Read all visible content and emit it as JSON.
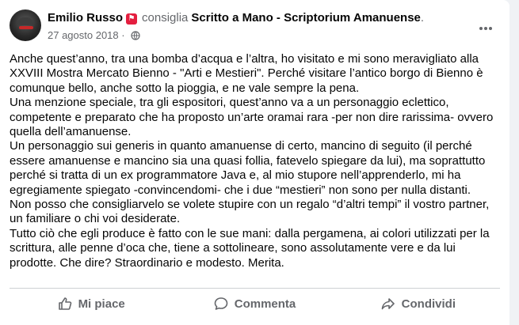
{
  "post": {
    "author": "Emilio Russo",
    "verb": "consiglia",
    "page": "Scritto a Mano - Scriptorium Amanuense",
    "page_suffix": ".",
    "date": "27 agosto 2018",
    "date_separator": " · ",
    "paragraphs": [
      "Anche quest’anno, tra una bomba d’acqua e l’altra, ho visitato e mi sono meravigliato alla XXVIII Mostra Mercato Bienno - \"Arti e Mestieri\". Perché visitare l’antico borgo di Bienno è comunque bello, anche sotto la pioggia, e ne vale sempre la pena.",
      "Una menzione speciale, tra gli espositori, quest’anno va a un personaggio eclettico, competente e preparato che ha proposto un’arte oramai rara -per non dire rarissima- ovvero quella dell’amanuense.",
      "Un personaggio sui generis in quanto amanuense di certo, mancino di seguito (il perché essere amanuense e mancino sia una quasi follia, fatevelo spiegare da lui), ma soprattutto perché si tratta di un ex programmatore Java e, al mio stupore nell’apprenderlo, mi ha egregiamente spiegato -convincendomi- che i due “mestieri” non sono per nulla distanti.",
      "Non posso che consigliarvelo se volete stupire con un regalo “d’altri tempi” il vostro partner, un familiare o chi voi desiderate.",
      "Tutto ciò che egli produce è fatto con le sue mani: dalla pergamena, ai colori utilizzati per la scrittura, alle penne d’oca che, tiene a sottolineare, sono assolutamente vere e da lui prodotte. Che dire? Straordinario e modesto. Merita."
    ]
  },
  "actions": {
    "like": "Mi piace",
    "comment": "Commenta",
    "share": "Condividi"
  },
  "icons": {
    "badge": "recommend-badge-icon",
    "privacy": "globe-icon",
    "more": "more-options-icon",
    "like": "thumbs-up-icon",
    "comment": "comment-bubble-icon",
    "share": "share-arrow-icon"
  },
  "colors": {
    "text": "#050505",
    "secondary": "#65676b",
    "badge": "#e41e3f",
    "divider": "#ced0d4"
  }
}
